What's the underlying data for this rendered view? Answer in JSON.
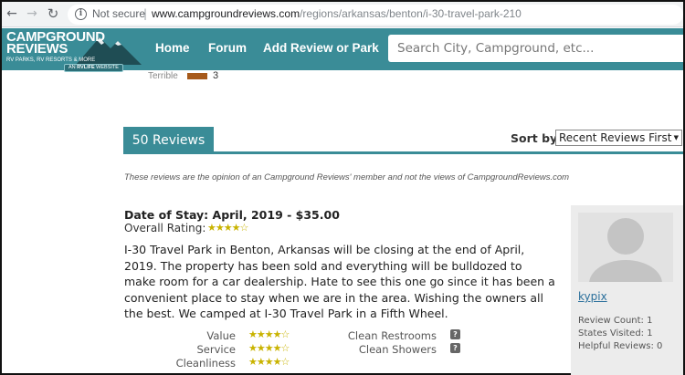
{
  "browser": {
    "security_label": "Not secure",
    "url_host": "www.campgroundreviews.com",
    "url_path": "/regions/arkansas/benton/i-30-travel-park-210"
  },
  "site": {
    "logo_line1": "CAMPGROUND",
    "logo_line2": "REVIEWS",
    "logo_sub": "RV PARKS, RV RESORTS & MORE",
    "logo_badge_prefix": "AN",
    "logo_badge_brand": "RVLIFE",
    "logo_badge_suffix": "WEBSITE",
    "nav": [
      "Home",
      "Forum",
      "Add Review or Park"
    ],
    "search_placeholder": "Search City, Campground, etc..."
  },
  "rating_breakdown": {
    "label": "Terrible",
    "count": "3",
    "bar_color": "#a65a1b"
  },
  "reviews": {
    "count_label": "50 Reviews",
    "sort_label": "Sort by",
    "sort_selected": "Recent Reviews First",
    "disclaimer": "These reviews are the opinion of an Campground Reviews' member and not the views of CampgroundReviews.com"
  },
  "review": {
    "stay": "Date of Stay: April, 2019 - $35.00",
    "overall_label": "Overall Rating:",
    "overall_stars": 4,
    "body": "I-30 Travel Park in Benton, Arkansas will be closing at the end of April, 2019. The property has been sold and everything will be bulldozed to make room for a car dealership. Hate to see this one go since it has been a convenient place to stay when we are in the area. Wishing the owners all the best. We camped at I-30 Travel Park in a Fifth Wheel.",
    "categories": [
      {
        "label": "Value",
        "stars": 4
      },
      {
        "label": "Service",
        "stars": 4
      },
      {
        "label": "Cleanliness",
        "stars": 4
      }
    ],
    "amenities": [
      {
        "label": "Clean Restrooms",
        "value": "?"
      },
      {
        "label": "Clean Showers",
        "value": "?"
      }
    ]
  },
  "user": {
    "name": "kypix",
    "review_count": "Review Count: 1",
    "states_visited": "States Visited: 1",
    "helpful_reviews": "Helpful Reviews: 0"
  },
  "colors": {
    "brand": "#3a8c97",
    "star": "#c9b300",
    "link": "#2a6f9b"
  }
}
